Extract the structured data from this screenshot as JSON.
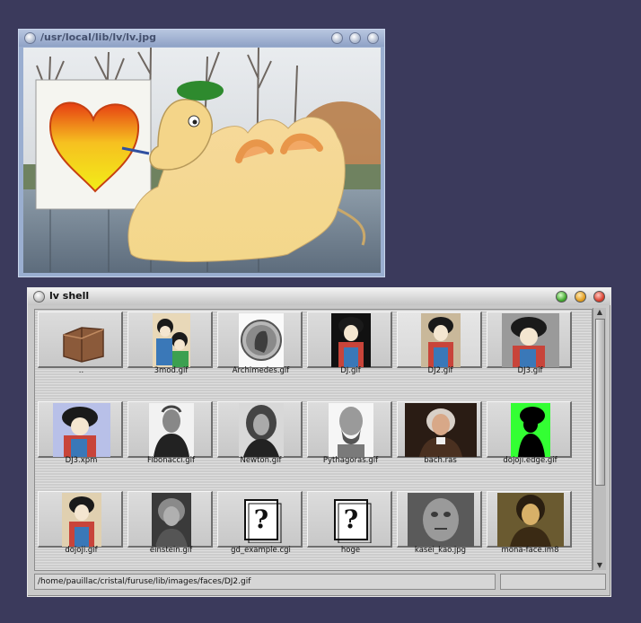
{
  "viewer": {
    "title": "/usr/local/lib/lv/lv.jpg"
  },
  "shell": {
    "title": "lv shell",
    "status_path": "/home/pauillac/cristal/furuse/lib/images/faces/DJ2.gif",
    "status_extra": "",
    "files": [
      {
        "label": "..",
        "icon": "folder-icon"
      },
      {
        "label": "3mod.gif",
        "icon": "ukiyoe-thumbnail"
      },
      {
        "label": "Archimedes.gif",
        "icon": "coin-portrait-thumbnail"
      },
      {
        "label": "DJ.gif",
        "icon": "ukiyoe-thumbnail"
      },
      {
        "label": "DJ2.gif",
        "icon": "ukiyoe-thumbnail"
      },
      {
        "label": "DJ3.gif",
        "icon": "ukiyoe-thumbnail"
      },
      {
        "label": "DJ3.xpm",
        "icon": "ukiyoe-thumbnail"
      },
      {
        "label": "Fibonacci.gif",
        "icon": "portrait-thumbnail"
      },
      {
        "label": "Newton.gif",
        "icon": "portrait-thumbnail"
      },
      {
        "label": "Pythagoras.gif",
        "icon": "bust-thumbnail"
      },
      {
        "label": "bach.ras",
        "icon": "portrait-thumbnail"
      },
      {
        "label": "dojoji.edge.gif",
        "icon": "silhouette-thumbnail"
      },
      {
        "label": "dojoji.gif",
        "icon": "ukiyoe-thumbnail"
      },
      {
        "label": "einstein.gif",
        "icon": "portrait-thumbnail"
      },
      {
        "label": "gd_example.cgi",
        "icon": "unknown-file-icon"
      },
      {
        "label": "hoge",
        "icon": "unknown-file-icon"
      },
      {
        "label": "kasei_kao.jpg",
        "icon": "mars-face-thumbnail"
      },
      {
        "label": "mona-face.im8",
        "icon": "mona-lisa-thumbnail"
      }
    ]
  },
  "colors": {
    "desktop": "#3b3a5c",
    "window_close": "#d63a2a",
    "window_minimize": "#e09a1c",
    "window_maximize": "#3ca32a"
  }
}
